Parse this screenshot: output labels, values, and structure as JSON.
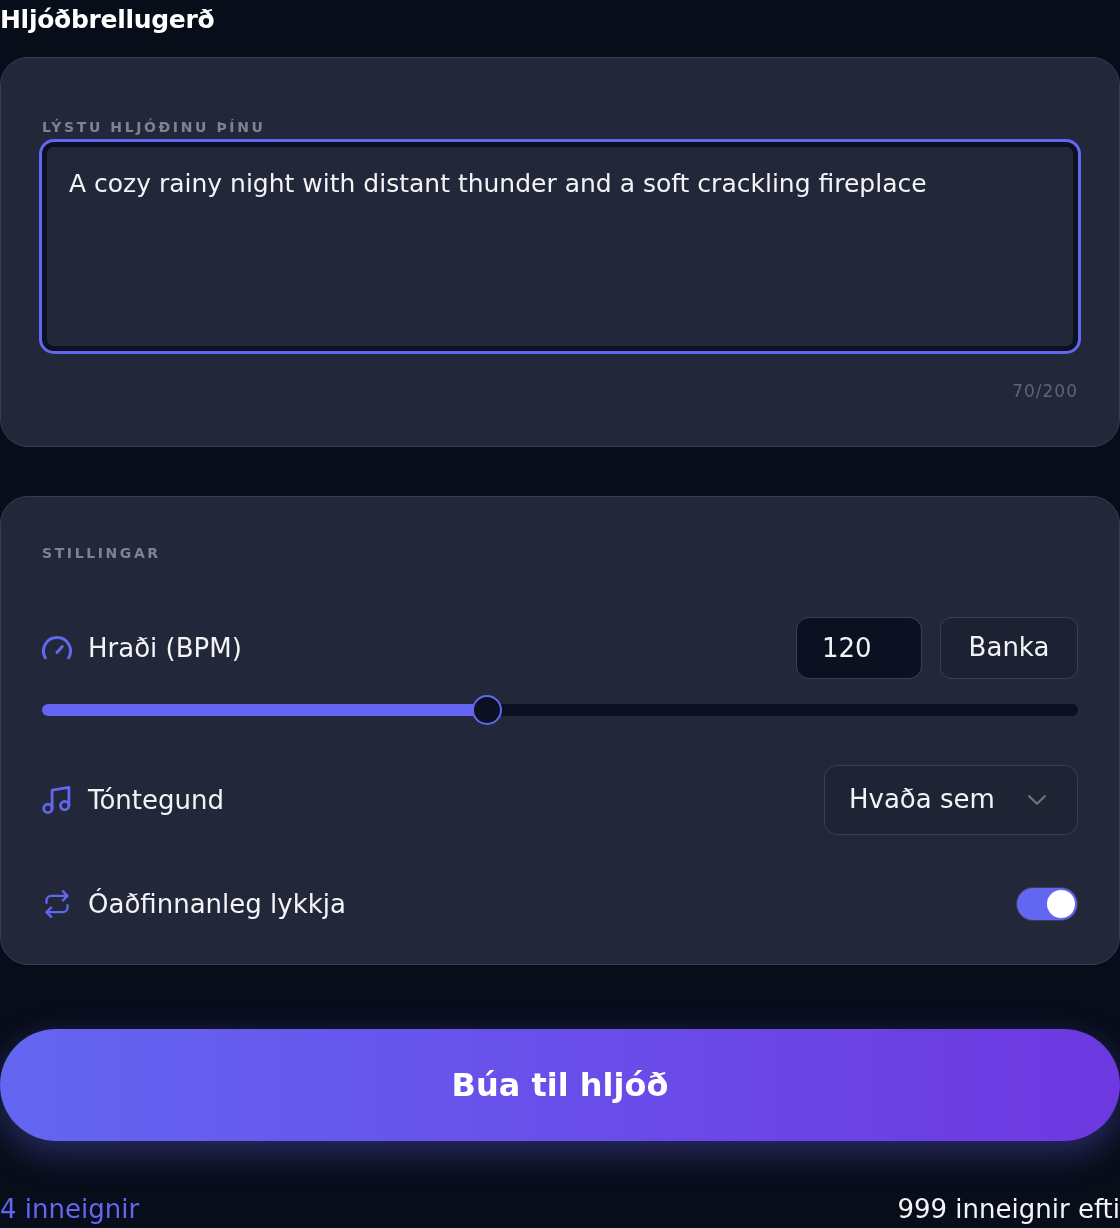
{
  "title": "Hljóðbrellugerð",
  "prompt": {
    "label": "LÝSTU HLJÓÐINU ÞÍNU",
    "value": "A cozy rainy night with distant thunder and a soft crackling fireplace",
    "counter": "70/200",
    "focused": true
  },
  "settings": {
    "heading": "STILLINGAR",
    "rows": [
      {
        "kind": "tempo",
        "label": "Hraði (BPM)",
        "value": "120",
        "button": "Banka",
        "level": 0.43
      },
      {
        "kind": "select",
        "label": "Tóntegund",
        "value": "Hvaða sem"
      },
      {
        "kind": "toggle",
        "label": "Óaðfinnanleg lykkja",
        "on": true
      }
    ]
  },
  "generate_button": "Búa til hljóð",
  "footer": {
    "credits_used": "4 inneignir",
    "credits_left": "999 inneignir efti"
  }
}
